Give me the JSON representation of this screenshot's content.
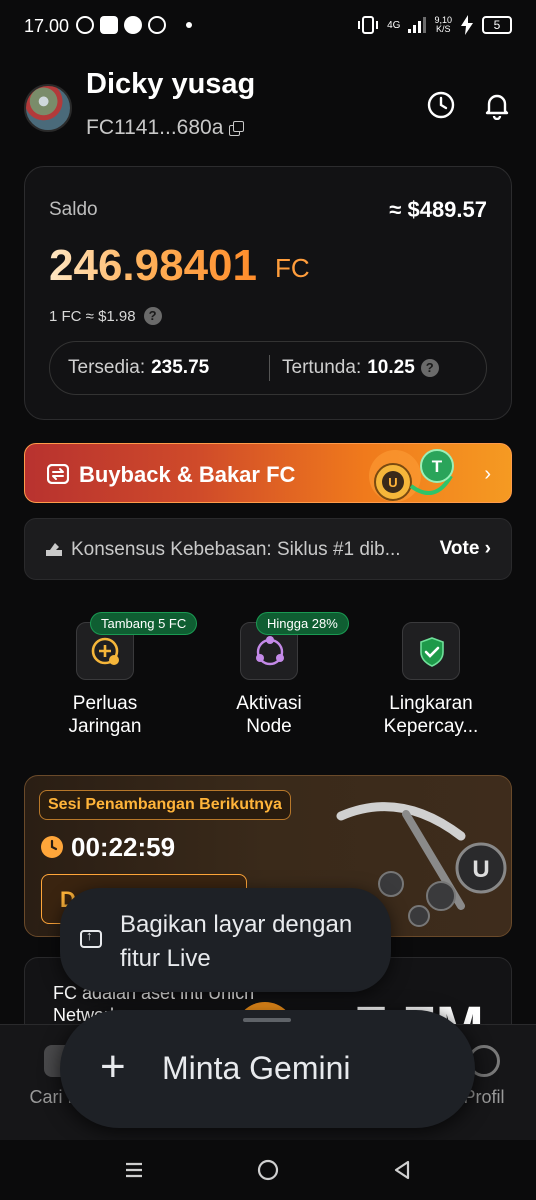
{
  "status_bar": {
    "time": "17.00",
    "network": "4G",
    "speed_value": "9,10",
    "speed_unit": "K/S",
    "battery": "5"
  },
  "header": {
    "username": "Dicky yusag",
    "address": "FC1141...680a"
  },
  "balance": {
    "label": "Saldo",
    "usd_value": "≈ $489.57",
    "amount": "246.98401",
    "unit": "FC",
    "rate": "1 FC ≈ $1.98",
    "available_label": "Tersedia:",
    "available_value": "235.75",
    "pending_label": "Tertunda:",
    "pending_value": "10.25",
    "accent_color": "#ff9d3c"
  },
  "buyback": {
    "label": "Buyback & Bakar FC"
  },
  "vote": {
    "text": "Konsensus Kebebasan: Siklus #1 dib...",
    "button": "Vote"
  },
  "actions": [
    {
      "badge": "Tambang 5 FC",
      "label_line1": "Perluas",
      "label_line2": "Jaringan",
      "icon": "plus-coin-icon"
    },
    {
      "badge": "Hingga 28%",
      "label_line1": "Aktivasi",
      "label_line2": "Node",
      "icon": "node-icon"
    },
    {
      "badge": "",
      "label_line1": "Lingkaran",
      "label_line2": "Kepercay...",
      "icon": "shield-check-icon"
    }
  ],
  "mining": {
    "badge": "Sesi Penambangan Berikutnya",
    "countdown": "00:22:59",
    "button_partial": "D"
  },
  "info": {
    "text_line1": "FC adalah aset inti Unich",
    "text_line2": "Network ... ",
    "big_value": "7.7M"
  },
  "bottom_nav": [
    {
      "label": "Cari No",
      "icon": "cards-icon"
    },
    {
      "label": "Profil",
      "icon": "profile-icon"
    }
  ],
  "gemini": {
    "share_live_text": "Bagikan layar dengan fitur Live",
    "prompt_label": "Minta Gemini",
    "plus_symbol": "+"
  }
}
